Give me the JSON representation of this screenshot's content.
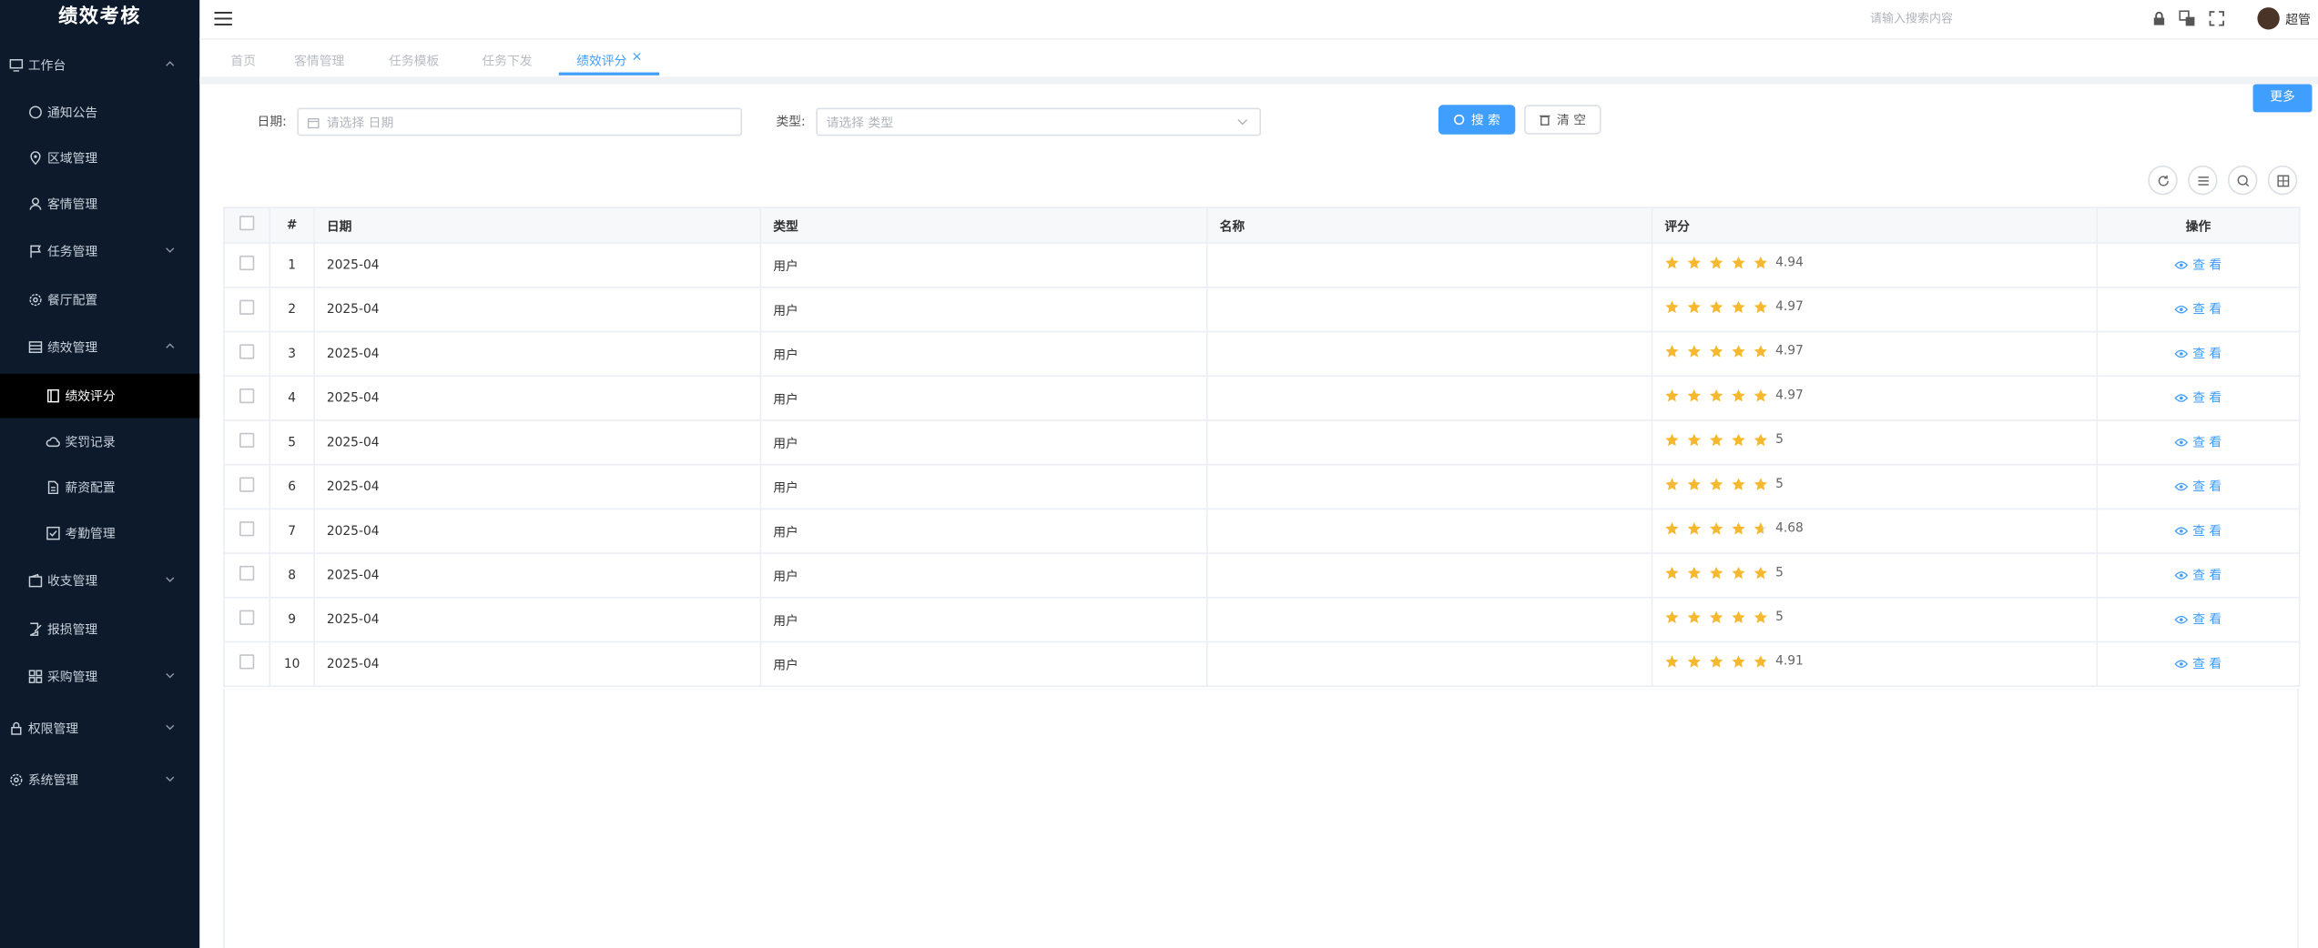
{
  "sidebar": {
    "title": "绩效考核",
    "items": [
      {
        "label": "工作台",
        "icon": "monitor-icon",
        "level": 0,
        "chevron": "up"
      },
      {
        "label": "通知公告",
        "icon": "message-icon",
        "level": 1
      },
      {
        "label": "区域管理",
        "icon": "location-icon",
        "level": 1
      },
      {
        "label": "客情管理",
        "icon": "user-icon",
        "level": 1
      },
      {
        "label": "任务管理",
        "icon": "flag-icon",
        "level": 1,
        "chevron": "down"
      },
      {
        "label": "餐厅配置",
        "icon": "gear-icon",
        "level": 1
      },
      {
        "label": "绩效管理",
        "icon": "table-icon",
        "level": 1,
        "chevron": "up"
      },
      {
        "label": "绩效评分",
        "icon": "book-icon",
        "level": 2,
        "active": true
      },
      {
        "label": "奖罚记录",
        "icon": "cloud-icon",
        "level": 2
      },
      {
        "label": "薪资配置",
        "icon": "document-icon",
        "level": 2
      },
      {
        "label": "考勤管理",
        "icon": "checkbox-icon",
        "level": 2
      },
      {
        "label": "收支管理",
        "icon": "wallet-icon",
        "level": 1,
        "chevron": "down"
      },
      {
        "label": "报损管理",
        "icon": "edit-icon",
        "level": 1
      },
      {
        "label": "采购管理",
        "icon": "grid-icon",
        "level": 1,
        "chevron": "down"
      },
      {
        "label": "权限管理",
        "icon": "lock-icon",
        "level": 0,
        "chevron": "down"
      },
      {
        "label": "系统管理",
        "icon": "gear-icon",
        "level": 0,
        "chevron": "down"
      }
    ]
  },
  "topbar": {
    "search_placeholder": "请输入搜索内容",
    "username": "超管"
  },
  "tabs": [
    {
      "label": "首页",
      "active": false
    },
    {
      "label": "客情管理",
      "active": false
    },
    {
      "label": "任务模板",
      "active": false
    },
    {
      "label": "任务下发",
      "active": false
    },
    {
      "label": "绩效评分",
      "active": true
    }
  ],
  "more_label": "更多",
  "filters": {
    "date_label": "日期:",
    "date_placeholder": "请选择 日期",
    "type_label": "类型:",
    "type_placeholder": "请选择 类型",
    "search_label": "搜 索",
    "clear_label": "清 空"
  },
  "table": {
    "columns": [
      "#",
      "日期",
      "类型",
      "名称",
      "评分",
      "操作"
    ],
    "view_label": "查 看",
    "rows": [
      {
        "index": "1",
        "date": "2025-04",
        "type": "用户",
        "name": "",
        "score": "4.94",
        "score_value": 4.94
      },
      {
        "index": "2",
        "date": "2025-04",
        "type": "用户",
        "name": "",
        "score": "4.97",
        "score_value": 4.97
      },
      {
        "index": "3",
        "date": "2025-04",
        "type": "用户",
        "name": "",
        "score": "4.97",
        "score_value": 4.97
      },
      {
        "index": "4",
        "date": "2025-04",
        "type": "用户",
        "name": "",
        "score": "4.97",
        "score_value": 4.97
      },
      {
        "index": "5",
        "date": "2025-04",
        "type": "用户",
        "name": "",
        "score": "5",
        "score_value": 5
      },
      {
        "index": "6",
        "date": "2025-04",
        "type": "用户",
        "name": "",
        "score": "5",
        "score_value": 5
      },
      {
        "index": "7",
        "date": "2025-04",
        "type": "用户",
        "name": "",
        "score": "4.68",
        "score_value": 4.68
      },
      {
        "index": "8",
        "date": "2025-04",
        "type": "用户",
        "name": "",
        "score": "5",
        "score_value": 5
      },
      {
        "index": "9",
        "date": "2025-04",
        "type": "用户",
        "name": "",
        "score": "5",
        "score_value": 5
      },
      {
        "index": "10",
        "date": "2025-04",
        "type": "用户",
        "name": "",
        "score": "4.91",
        "score_value": 4.91
      }
    ]
  },
  "colors": {
    "sidebar_bg": "#0c1a2b",
    "accent": "#409eff",
    "star": "#f5b82e"
  }
}
